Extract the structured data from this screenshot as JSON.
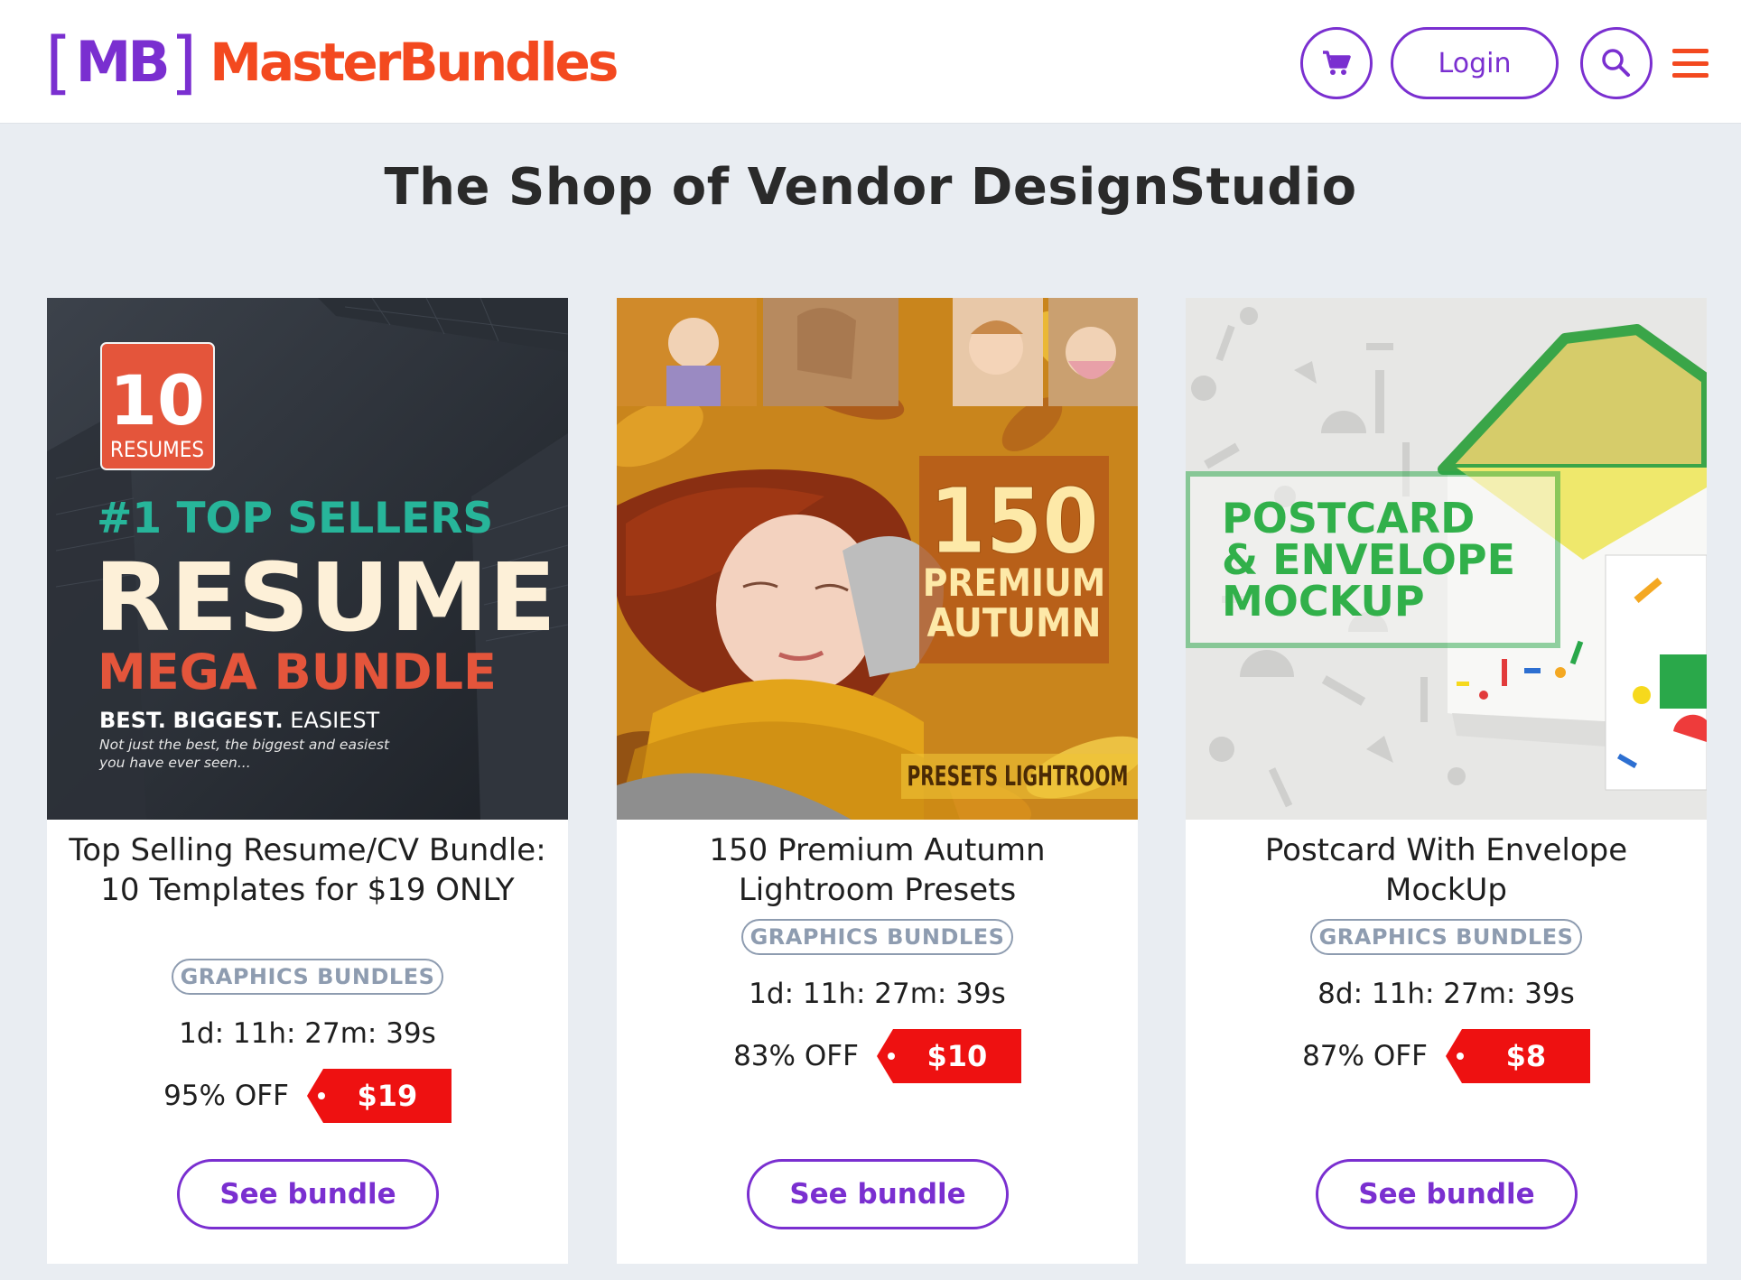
{
  "header": {
    "logo_mark": "MB",
    "logo_text": "MasterBundles",
    "login_label": "Login",
    "cart_icon": "cart-icon",
    "search_icon": "search-icon",
    "menu_icon": "hamburger-menu-icon"
  },
  "page": {
    "title": "The Shop of Vendor DesignStudio"
  },
  "colors": {
    "brand_purple": "#7a2fd0",
    "brand_orange": "#f3491f",
    "price_red": "#ee1111",
    "page_bg": "#e9edf2",
    "badge_gray": "#8e9cb0"
  },
  "products": [
    {
      "image_text": {
        "number": "10",
        "resumes": "RESUMES",
        "line1": "#1 TOP SELLERS",
        "line2": "RESUME",
        "line3": "MEGA BUNDLE",
        "tagline_best": "BEST.",
        "tagline_biggest": "BIGGEST.",
        "tagline_easiest": "EASIEST",
        "sub1": "Not just the best, the biggest and easiest",
        "sub2": "you have ever seen..."
      },
      "title": "Top Selling Resume/CV Bundle: 10 Templates for $19 ONLY",
      "category": "GRAPHICS BUNDLES",
      "countdown": "1d: 11h: 27m: 39s",
      "discount": "95% OFF",
      "price": "$19",
      "button": "See bundle"
    },
    {
      "image_text": {
        "number": "150",
        "line1": "PREMIUM",
        "line2": "AUTUMN",
        "line3": "PRESETS LIGHTROOM"
      },
      "title": "150 Premium Autumn Lightroom Presets",
      "category": "GRAPHICS BUNDLES",
      "countdown": "1d: 11h: 27m: 39s",
      "discount": "83% OFF",
      "price": "$10",
      "button": "See bundle"
    },
    {
      "image_text": {
        "line1": "POSTCARD",
        "line2": "& ENVELOPE",
        "line3": "MOCKUP"
      },
      "title": "Postcard With Envelope MockUp",
      "category": "GRAPHICS BUNDLES",
      "countdown": "8d: 11h: 27m: 39s",
      "discount": "87% OFF",
      "price": "$8",
      "button": "See bundle"
    }
  ]
}
